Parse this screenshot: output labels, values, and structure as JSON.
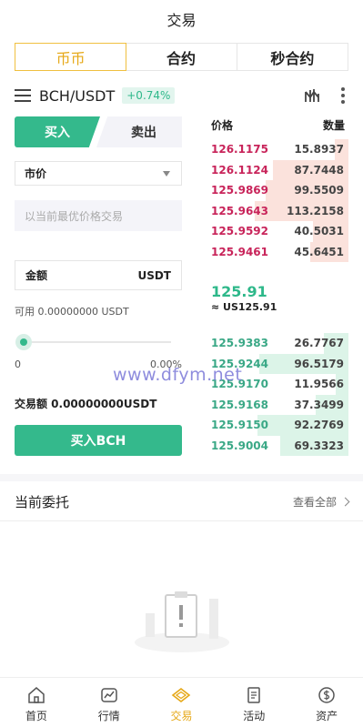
{
  "header": {
    "title": "交易"
  },
  "tabs": [
    {
      "label": "币币",
      "active": true
    },
    {
      "label": "合约",
      "active": false
    },
    {
      "label": "秒合约",
      "active": false
    }
  ],
  "pair": {
    "name": "BCH/USDT",
    "change": "+0.74%"
  },
  "icons": {
    "menu": "list-menu-icon",
    "chart": "candlestick-chart-icon",
    "more": "more-vertical-icon"
  },
  "trade": {
    "buy_label": "买入",
    "sell_label": "卖出",
    "order_type": "市价",
    "price_placeholder": "以当前最优价格交易",
    "amount_label": "金额",
    "amount_unit": "USDT",
    "available": "可用 0.00000000 USDT",
    "slider": {
      "min_label": "0",
      "max_label": "0.00%",
      "value": 0
    },
    "trade_amount": "交易额 0.00000000USDT",
    "submit_label": "买入BCH"
  },
  "orderbook": {
    "price_header": "价格",
    "amount_header": "数量",
    "asks": [
      {
        "price": "126.1175",
        "amount": "15.8937",
        "depth": 0.1
      },
      {
        "price": "126.1124",
        "amount": "87.7448",
        "depth": 0.55
      },
      {
        "price": "125.9869",
        "amount": "99.5509",
        "depth": 0.6
      },
      {
        "price": "125.9643",
        "amount": "113.2158",
        "depth": 0.68
      },
      {
        "price": "125.9592",
        "amount": "40.5031",
        "depth": 0.26
      },
      {
        "price": "125.9461",
        "amount": "45.6451",
        "depth": 0.28
      }
    ],
    "last_price": "125.91",
    "last_price_fiat": "≈ US125.91",
    "bids": [
      {
        "price": "125.9383",
        "amount": "26.7767",
        "depth": 0.18
      },
      {
        "price": "125.9244",
        "amount": "96.5179",
        "depth": 0.65
      },
      {
        "price": "125.9170",
        "amount": "11.9566",
        "depth": 0.09
      },
      {
        "price": "125.9168",
        "amount": "37.3499",
        "depth": 0.24
      },
      {
        "price": "125.9150",
        "amount": "92.2769",
        "depth": 0.66
      },
      {
        "price": "125.9004",
        "amount": "69.3323",
        "depth": 0.5
      }
    ]
  },
  "watermark": "www.dfym.net",
  "orders": {
    "title": "当前委托",
    "view_all": "查看全部"
  },
  "nav": [
    {
      "label": "首页",
      "icon": "home-icon",
      "active": false
    },
    {
      "label": "行情",
      "icon": "market-icon",
      "active": false
    },
    {
      "label": "交易",
      "icon": "trade-icon",
      "active": true
    },
    {
      "label": "活动",
      "icon": "activity-icon",
      "active": false
    },
    {
      "label": "资产",
      "icon": "assets-icon",
      "active": false
    }
  ],
  "colors": {
    "accent": "#34b98c",
    "ask": "#c8245a",
    "bid": "#3aa886",
    "active_tab": "#e6a817"
  }
}
